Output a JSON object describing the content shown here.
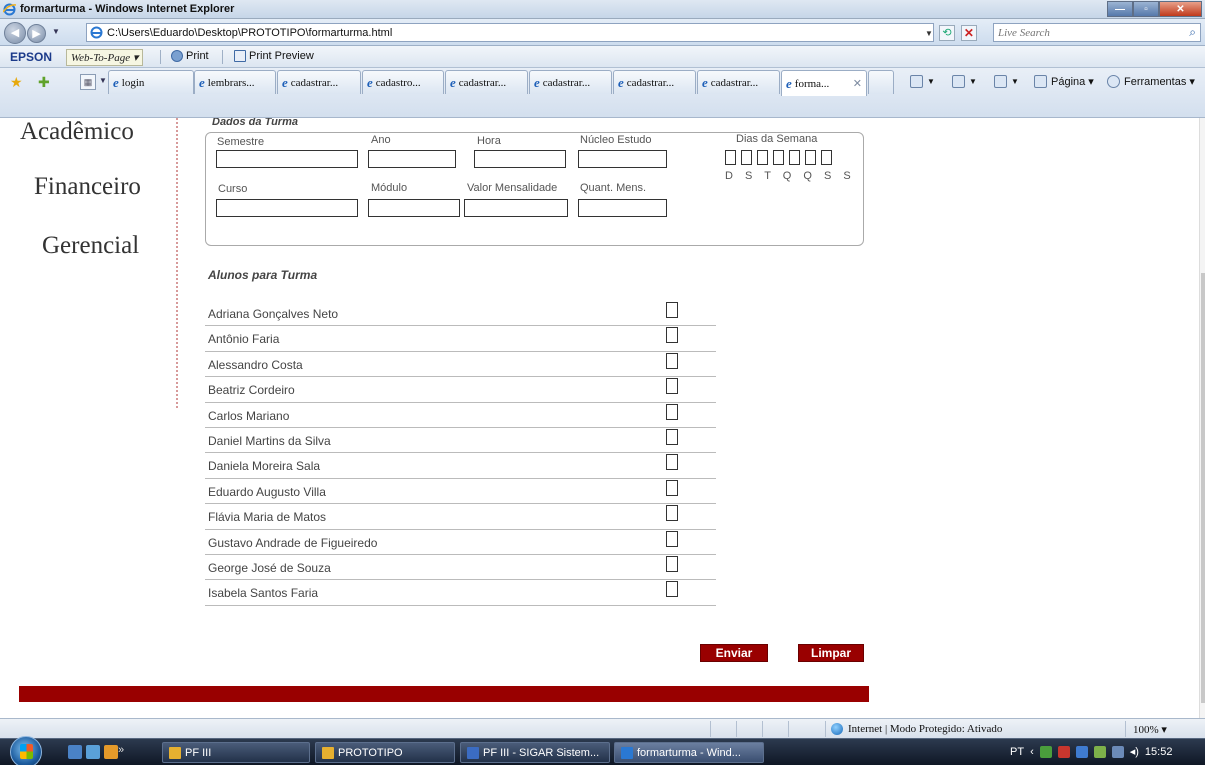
{
  "window": {
    "title": "formarturma - Windows Internet Explorer",
    "url": "C:\\Users\\Eduardo\\Desktop\\PROTOTIPO\\formarturma.html",
    "search_placeholder": "Live Search"
  },
  "epsonbar": {
    "brand": "EPSON",
    "webtopage": "Web-To-Page ▾",
    "print": "Print",
    "print_preview": "Print Preview"
  },
  "tabs": [
    "login",
    "lembrars...",
    "cadastrar...",
    "cadastro...",
    "cadastrar...",
    "cadastrar...",
    "cadastrar...",
    "cadastrar...",
    "forma..."
  ],
  "toolbar": {
    "pagina": "Página ▾",
    "ferramentas": "Ferramentas ▾"
  },
  "nav": {
    "academico": "Acadêmico",
    "financeiro": "Financeiro",
    "gerencial": "Gerencial"
  },
  "form": {
    "legend": "Dados da Turma",
    "semestre": "Semestre",
    "ano": "Ano",
    "hora": "Hora",
    "nucleo": "Núcleo Estudo",
    "dias": "Dias da Semana",
    "dias_letras": "D S T Q Q S S",
    "curso": "Curso",
    "modulo": "Módulo",
    "valor": "Valor Mensalidade",
    "quant": "Quant. Mens."
  },
  "alunos": {
    "title": "Alunos para Turma",
    "names": [
      "Adriana Gonçalves Neto",
      "Antônio Faria",
      "Alessandro Costa",
      "Beatriz Cordeiro",
      "Carlos Mariano",
      "Daniel Martins da Silva",
      "Daniela Moreira Sala",
      "Eduardo  Augusto Villa",
      "Flávia Maria de Matos",
      "Gustavo Andrade de Figueiredo",
      "George José de Souza",
      "Isabela Santos Faria"
    ]
  },
  "buttons": {
    "enviar": "Enviar",
    "limpar": "Limpar"
  },
  "status": {
    "zone": "Internet | Modo Protegido: Ativado",
    "zoom": "100%  ▾"
  },
  "taskbar": {
    "items": [
      "PF III",
      "PROTOTIPO",
      "PF III - SIGAR Sistem...",
      "formarturma - Wind..."
    ],
    "lang": "PT",
    "clock": "15:52"
  },
  "colors": {
    "accent": "#990000",
    "nav_divider": "#d79a9a"
  }
}
